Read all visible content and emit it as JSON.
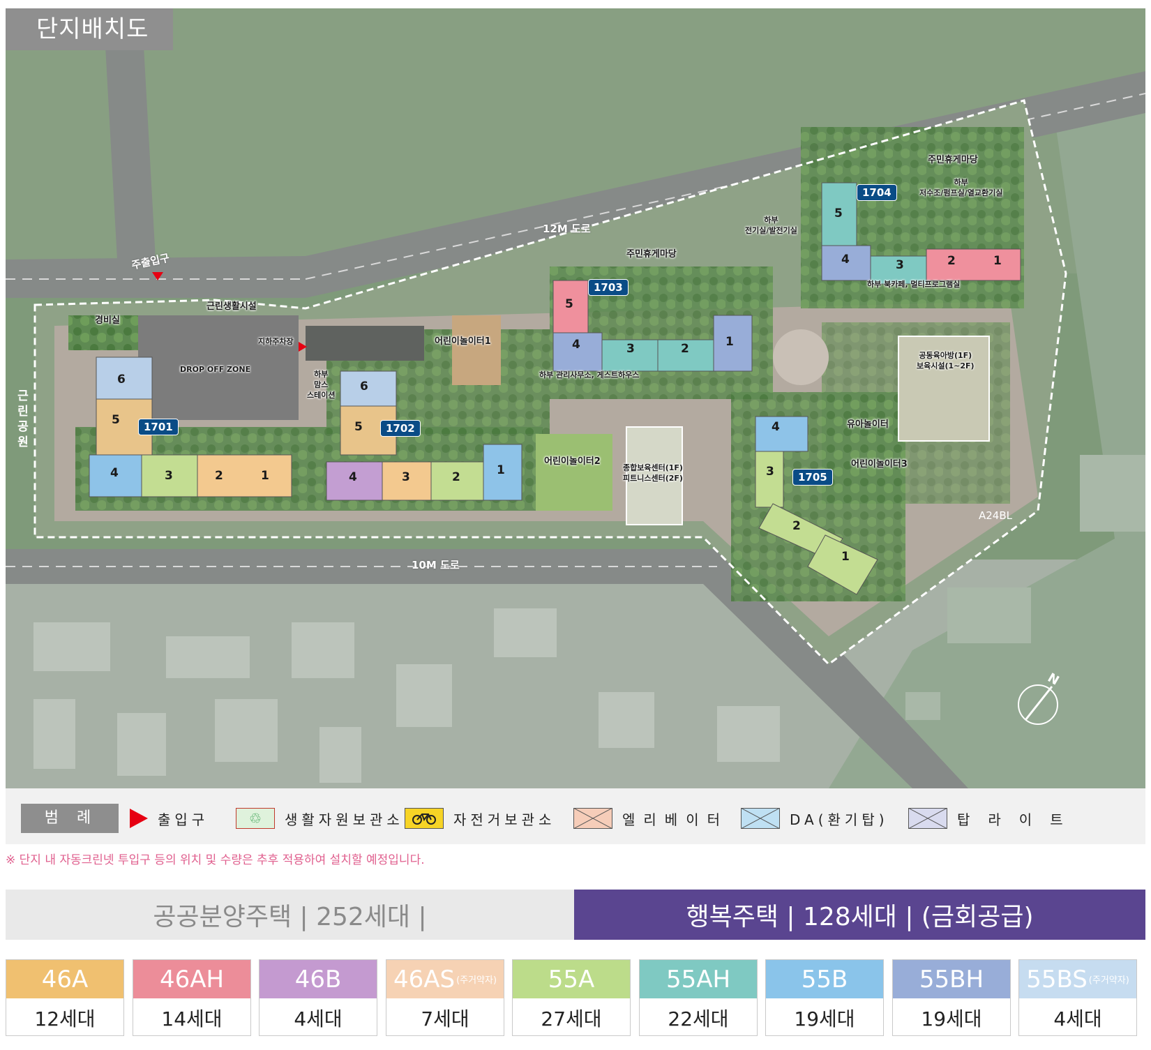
{
  "map": {
    "title": "단지배치도",
    "roads": {
      "north": "12M 도로",
      "south": "10M 도로"
    },
    "entrance": "주출입구",
    "park": "근린공원",
    "neighbor": "A24BL",
    "buildings": [
      {
        "no": "1701",
        "units": [
          "6",
          "5",
          "4",
          "3",
          "2",
          "1"
        ]
      },
      {
        "no": "1702",
        "units": [
          "6",
          "5",
          "4",
          "3",
          "2",
          "1"
        ]
      },
      {
        "no": "1703",
        "units": [
          "5",
          "4",
          "3",
          "2",
          "1"
        ]
      },
      {
        "no": "1704",
        "units": [
          "5",
          "4",
          "3",
          "2",
          "1"
        ]
      },
      {
        "no": "1705",
        "units": [
          "4",
          "3",
          "2",
          "1"
        ]
      }
    ],
    "facilities": {
      "guard": "경비실",
      "retail": "근린생활시설",
      "parking": "지하주차장",
      "dropoff": "DROP OFF ZONE",
      "moms_station": "하부\n맘스\n스테이션",
      "playground1": "어린이놀이터1",
      "playground2": "어린이놀이터2",
      "playground3": "어린이놀이터3",
      "toddler_play": "유아놀이터",
      "rest_yard": "주민휴게마당",
      "rest_yard2": "주민휴게마당",
      "electric": "하부\n전기실/발전기실",
      "water": "하부\n저수조/펌프실/열교환기실",
      "book_cafe": "하부 북카페, 멀티프로그램실",
      "office": "하부 관리사무소, 게스트하우스",
      "childcare": "종합보육센터(1F)\n피트니스센터(2F)",
      "nursery": "공동육아방(1F)\n보육시설(1~2F)"
    }
  },
  "legend": {
    "title": "범례",
    "items": [
      {
        "label": "출입구",
        "icon": "entrance-triangle-icon"
      },
      {
        "label": "생활자원보관소",
        "icon": "recycle-icon"
      },
      {
        "label": "자전거보관소",
        "icon": "bicycle-icon"
      },
      {
        "label": "엘리베이터",
        "icon": "elevator-icon"
      },
      {
        "label": "DA(환기탑)",
        "icon": "ventilation-icon"
      },
      {
        "label": "탑라이트",
        "icon": "toplight-icon"
      }
    ]
  },
  "note": "※ 단지 내 자동크린넷 투입구 등의 위치 및 수량은 추후 적용하여 설치할 예정입니다.",
  "supply": {
    "public": "공공분양주택  | 252세대 |",
    "happy": "행복주택  | 128세대 | (금회공급)"
  },
  "types": [
    {
      "name": "46A",
      "sub": "",
      "count": "12세대",
      "color": "#f0c070"
    },
    {
      "name": "46AH",
      "sub": "",
      "count": "14세대",
      "color": "#ec8d99"
    },
    {
      "name": "46B",
      "sub": "",
      "count": "4세대",
      "color": "#c49ad0"
    },
    {
      "name": "46AS",
      "sub": "(주거약자)",
      "count": "7세대",
      "color": "#f6d2b4"
    },
    {
      "name": "55A",
      "sub": "",
      "count": "27세대",
      "color": "#bcdc8a"
    },
    {
      "name": "55AH",
      "sub": "",
      "count": "22세대",
      "color": "#7fc9c2"
    },
    {
      "name": "55B",
      "sub": "",
      "count": "19세대",
      "color": "#8ac4ea"
    },
    {
      "name": "55BH",
      "sub": "",
      "count": "19세대",
      "color": "#98add8"
    },
    {
      "name": "55BS",
      "sub": "(주거약자)",
      "count": "4세대",
      "color": "#c6dcf0"
    }
  ]
}
